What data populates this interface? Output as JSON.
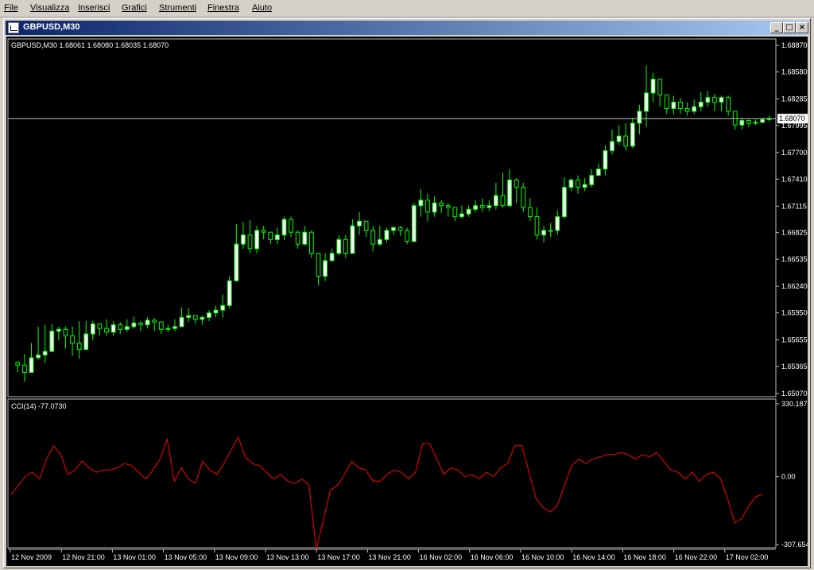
{
  "menu": {
    "items": [
      "File",
      "Visualizza",
      "Inserisci",
      "Grafici",
      "Strumenti",
      "Finestra",
      "Aiuto"
    ]
  },
  "window": {
    "title": "GBPUSD,M30",
    "icon": "chart-window-icon",
    "buttons": {
      "minimize": "_",
      "maximize": "□",
      "close": "×"
    }
  },
  "chart": {
    "header": "GBPUSD,M30  1.68061 1.68080 1.68035 1.68070",
    "current_price_label": "1.68070",
    "current_price": 1.6807,
    "price_color": "#00ff00",
    "bull_fill": "#ffffff",
    "bear_fill": "#000000",
    "grid_color": "#c0c0c0",
    "indicator_line_color": "#ff0000",
    "indicator_header": "CCI(14) -77.0730"
  },
  "chart_data": [
    {
      "type": "candlestick",
      "title": "GBPUSD,M30",
      "ylim": [
        1.6507,
        1.6887
      ],
      "y_ticks": [
        "1.68870",
        "1.68580",
        "1.68285",
        "1.67995",
        "1.67700",
        "1.67410",
        "1.67115",
        "1.66825",
        "1.66535",
        "1.66240",
        "1.65950",
        "1.65655",
        "1.65365",
        "1.65070"
      ],
      "x_ticks": [
        "12 Nov 2009",
        "12 Nov 21:00",
        "13 Nov 01:00",
        "13 Nov 05:00",
        "13 Nov 09:00",
        "13 Nov 13:00",
        "13 Nov 17:00",
        "13 Nov 21:00",
        "16 Nov 02:00",
        "16 Nov 06:00",
        "16 Nov 10:00",
        "16 Nov 14:00",
        "16 Nov 18:00",
        "16 Nov 22:00",
        "17 Nov 02:00"
      ],
      "close": [
        1.6538,
        1.653,
        1.6546,
        1.6549,
        1.6553,
        1.6575,
        1.6577,
        1.657,
        1.6562,
        1.6555,
        1.6572,
        1.6583,
        1.6578,
        1.6574,
        1.6582,
        1.6577,
        1.658,
        1.6584,
        1.6582,
        1.6587,
        1.6585,
        1.6577,
        1.6578,
        1.658,
        1.659,
        1.6592,
        1.6588,
        1.659,
        1.6595,
        1.6598,
        1.6603,
        1.663,
        1.667,
        1.668,
        1.6665,
        1.6685,
        1.6683,
        1.6675,
        1.668,
        1.6697,
        1.6683,
        1.667,
        1.6683,
        1.666,
        1.6635,
        1.6652,
        1.666,
        1.6675,
        1.666,
        1.669,
        1.6695,
        1.6685,
        1.667,
        1.6675,
        1.6685,
        1.6688,
        1.6685,
        1.6673,
        1.6712,
        1.6718,
        1.6705,
        1.6715,
        1.6712,
        1.671,
        1.67,
        1.6703,
        1.6708,
        1.6712,
        1.671,
        1.6712,
        1.6723,
        1.6712,
        1.674,
        1.6732,
        1.671,
        1.67,
        1.668,
        1.6685,
        1.6685,
        1.67,
        1.6732,
        1.674,
        1.6732,
        1.6735,
        1.6745,
        1.6752,
        1.6772,
        1.6782,
        1.6788,
        1.6777,
        1.6802,
        1.6815,
        1.6835,
        1.685,
        1.6833,
        1.6818,
        1.6825,
        1.6818,
        1.6815,
        1.682,
        1.6825,
        1.683,
        1.6825,
        1.683,
        1.6815,
        1.68,
        1.6805,
        1.6802,
        1.6803,
        1.6806,
        1.6807
      ],
      "high": [
        1.6542,
        1.655,
        1.6562,
        1.658,
        1.6582,
        1.6583,
        1.658,
        1.658,
        1.658,
        1.6586,
        1.6586,
        1.6586,
        1.6583,
        1.6588,
        1.6586,
        1.6585,
        1.6588,
        1.6591,
        1.6586,
        1.659,
        1.6589,
        1.658,
        1.6582,
        1.6588,
        1.6601,
        1.66,
        1.6592,
        1.6592,
        1.6598,
        1.6603,
        1.6615,
        1.6635,
        1.6692,
        1.6694,
        1.6696,
        1.669,
        1.669,
        1.6681,
        1.6688,
        1.67,
        1.67,
        1.6685,
        1.669,
        1.6685,
        1.666,
        1.666,
        1.6665,
        1.668,
        1.668,
        1.6697,
        1.6705,
        1.6695,
        1.669,
        1.669,
        1.6688,
        1.669,
        1.669,
        1.6688,
        1.6715,
        1.673,
        1.6725,
        1.6722,
        1.6718,
        1.6715,
        1.671,
        1.6712,
        1.6712,
        1.6718,
        1.672,
        1.6718,
        1.6737,
        1.6748,
        1.6752,
        1.6742,
        1.6737,
        1.672,
        1.671,
        1.669,
        1.6693,
        1.6707,
        1.6743,
        1.6742,
        1.6745,
        1.6742,
        1.6752,
        1.6758,
        1.6778,
        1.6795,
        1.68,
        1.6802,
        1.6808,
        1.6822,
        1.6865,
        1.6857,
        1.6845,
        1.683,
        1.6832,
        1.683,
        1.6825,
        1.6828,
        1.6836,
        1.6837,
        1.6834,
        1.6832,
        1.6832,
        1.6815,
        1.6808,
        1.6806,
        1.6806,
        1.6808,
        1.681
      ],
      "low": [
        1.653,
        1.652,
        1.6532,
        1.6544,
        1.654,
        1.6552,
        1.6565,
        1.6556,
        1.6548,
        1.6545,
        1.6555,
        1.6565,
        1.657,
        1.657,
        1.657,
        1.6572,
        1.6574,
        1.6578,
        1.6575,
        1.6578,
        1.6575,
        1.6572,
        1.6574,
        1.6575,
        1.658,
        1.6585,
        1.6583,
        1.6582,
        1.6586,
        1.659,
        1.659,
        1.66,
        1.663,
        1.6665,
        1.666,
        1.666,
        1.6675,
        1.667,
        1.667,
        1.6675,
        1.6678,
        1.6665,
        1.6668,
        1.6655,
        1.6625,
        1.663,
        1.6655,
        1.6658,
        1.6655,
        1.666,
        1.668,
        1.6678,
        1.6662,
        1.6668,
        1.6672,
        1.668,
        1.6679,
        1.667,
        1.6672,
        1.67,
        1.6695,
        1.67,
        1.6704,
        1.67,
        1.6695,
        1.6698,
        1.67,
        1.6705,
        1.6705,
        1.6706,
        1.6708,
        1.671,
        1.671,
        1.6715,
        1.6705,
        1.6695,
        1.6675,
        1.6672,
        1.6678,
        1.668,
        1.6698,
        1.6728,
        1.6725,
        1.6728,
        1.6732,
        1.6745,
        1.6745,
        1.6768,
        1.6778,
        1.6772,
        1.6775,
        1.679,
        1.6798,
        1.6825,
        1.682,
        1.6812,
        1.6812,
        1.6812,
        1.681,
        1.6812,
        1.6815,
        1.682,
        1.6815,
        1.6815,
        1.681,
        1.6795,
        1.6795,
        1.6798,
        1.68,
        1.6802,
        1.6804
      ]
    },
    {
      "type": "line",
      "title": "CCI(14) -77.0730",
      "ylim": [
        -307.654,
        330.1871
      ],
      "y_ticks": [
        "330.1871",
        "0.00",
        "-307.654"
      ],
      "series": [
        {
          "name": "CCI(14)",
          "values": [
            -80,
            -40,
            0,
            20,
            -10,
            80,
            140,
            100,
            10,
            30,
            70,
            40,
            20,
            30,
            30,
            40,
            60,
            50,
            20,
            -10,
            30,
            80,
            170,
            -20,
            40,
            -10,
            -30,
            70,
            30,
            10,
            60,
            120,
            180,
            90,
            60,
            50,
            20,
            -10,
            10,
            -20,
            -30,
            -10,
            -40,
            -330,
            -200,
            -60,
            -40,
            10,
            70,
            40,
            30,
            -20,
            -20,
            10,
            30,
            20,
            -10,
            20,
            150,
            150,
            80,
            10,
            40,
            30,
            0,
            10,
            -10,
            20,
            0,
            40,
            60,
            140,
            140,
            20,
            -100,
            -140,
            -160,
            -130,
            -40,
            50,
            80,
            60,
            80,
            90,
            100,
            100,
            110,
            100,
            80,
            100,
            90,
            110,
            70,
            30,
            20,
            -10,
            20,
            -20,
            10,
            20,
            -10,
            -100,
            -210,
            -190,
            -130,
            -90,
            -80
          ]
        }
      ]
    }
  ]
}
